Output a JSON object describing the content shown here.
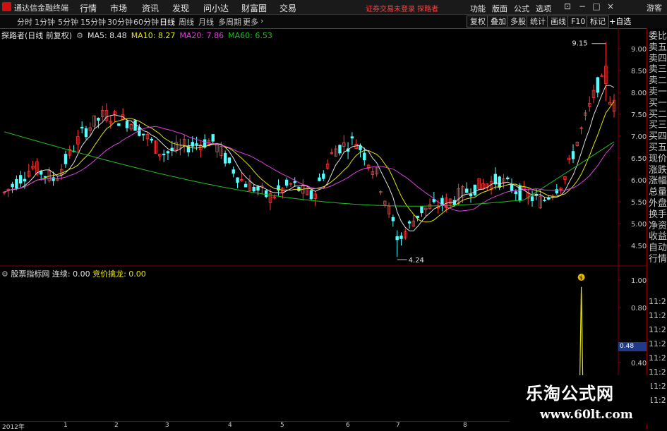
{
  "app": {
    "name": "通达信金融终端",
    "menu": [
      "行情",
      "市场",
      "资讯",
      "发现",
      "问小达",
      "财富圈",
      "交易"
    ],
    "notice": "证券交易未登录  探路者",
    "right_menu": [
      "功能",
      "版面",
      "公式",
      "选项"
    ],
    "guest": "游客"
  },
  "toolbar": {
    "periods": [
      "分时",
      "1分钟",
      "5分钟",
      "15分钟",
      "30分钟",
      "60分钟",
      "日线",
      "周线",
      "月线",
      "多周期",
      "更多"
    ],
    "active_period": "日线",
    "buttons": [
      "复权",
      "叠加",
      "多股",
      "统计",
      "画线",
      "F10",
      "标记"
    ],
    "add_watch": "+自选"
  },
  "main_chart": {
    "stock": "探路者(日线 前复权)",
    "ma": [
      {
        "label": "MA5: 8.48",
        "color": "#e0e0e0"
      },
      {
        "label": "MA10: 8.27",
        "color": "#e6e600"
      },
      {
        "label": "MA20: 7.86",
        "color": "#e040e0"
      },
      {
        "label": "MA60: 6.53",
        "color": "#20c020"
      }
    ],
    "y_ticks": [
      "9.00",
      "8.50",
      "8.00",
      "7.50",
      "7.00",
      "6.50",
      "6.00",
      "5.50",
      "5.00",
      "4.50"
    ],
    "high_label": "9.15",
    "low_label": "4.24"
  },
  "indicator": {
    "name": "股票指标网",
    "items": [
      {
        "label": "连续: 0.00",
        "color": "#c8c8c8"
      },
      {
        "label": "竞价擒龙: 0.00",
        "color": "#e6e600"
      }
    ],
    "y_ticks": [
      "1.00",
      "0.80",
      "0.48",
      "0.40"
    ],
    "current_value": "0.48"
  },
  "right_panel": {
    "labels": [
      "委比",
      "卖五",
      "卖四",
      "卖三",
      "卖二",
      "卖一",
      "买一",
      "买二",
      "买三",
      "买四",
      "买五",
      "现价",
      "涨跌",
      "涨幅",
      "总量",
      "外盘",
      "换手",
      "净资",
      "收益",
      "自动",
      "行情"
    ],
    "times": [
      "11:2",
      "11:2",
      "11:2",
      "11:2",
      "11:2",
      "11:2",
      "11:2",
      "11:2"
    ]
  },
  "x_axis": [
    "2012年",
    "1",
    "2",
    "3",
    "4",
    "5",
    "6",
    "7",
    "8"
  ],
  "watermark": {
    "title": "乐淘公式网",
    "url": "www.60lt.com"
  }
}
